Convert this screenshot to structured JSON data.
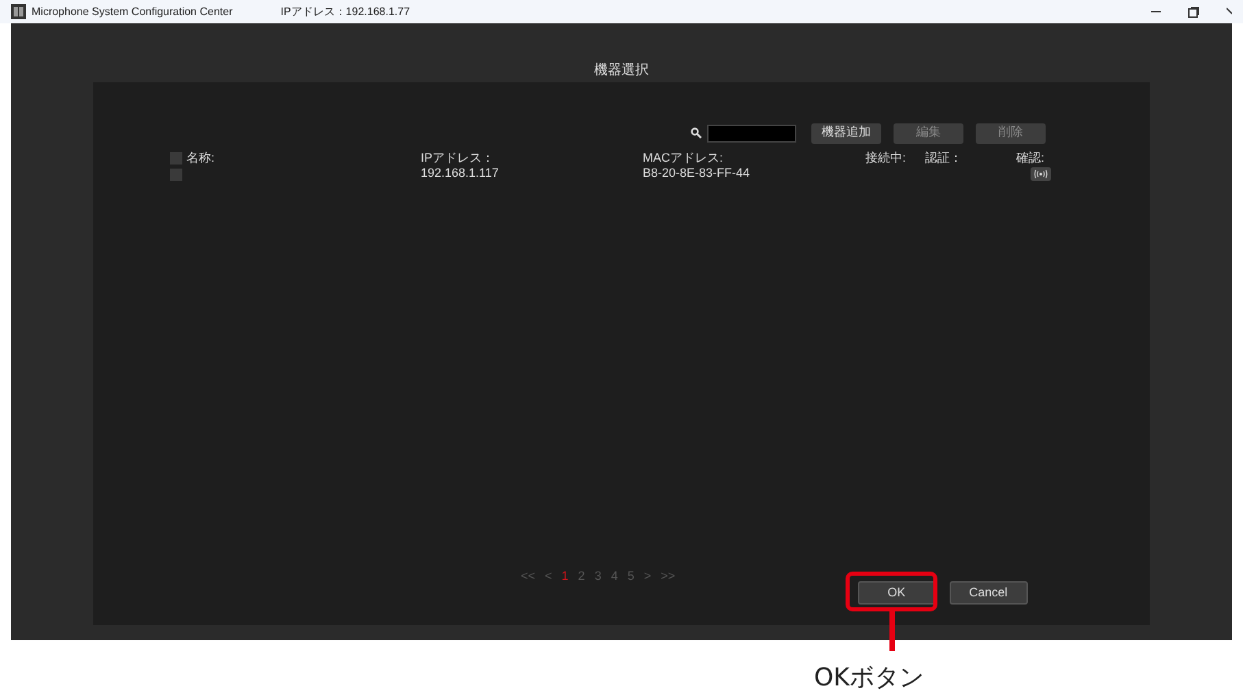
{
  "window": {
    "title": "Microphone System Configuration Center",
    "ip_label": "IPアドレス：192.168.1.77"
  },
  "dialog": {
    "title": "機器選択"
  },
  "toolbar": {
    "buttons": [
      {
        "label": "機器追加",
        "disabled": false
      },
      {
        "label": "編集",
        "disabled": true
      },
      {
        "label": "削除",
        "disabled": true
      }
    ]
  },
  "table": {
    "columns": [
      "名称:",
      "IPアドレス：",
      "MACアドレス:",
      "接続中:",
      "認証：",
      "確認:"
    ],
    "header_checked": false,
    "rows": [
      {
        "checked": false,
        "name": "",
        "ip": "192.168.1.117",
        "mac": "B8-20-8E-83-FF-44"
      }
    ]
  },
  "pagination": [
    {
      "label": "<<",
      "selected": false
    },
    {
      "label": "<",
      "selected": false
    },
    {
      "label": "1",
      "selected": true
    },
    {
      "label": "2",
      "selected": false
    },
    {
      "label": "3",
      "selected": false
    },
    {
      "label": "4",
      "selected": false
    },
    {
      "label": "5",
      "selected": false
    },
    {
      "label": ">",
      "selected": false
    },
    {
      "label": ">>",
      "selected": false
    }
  ],
  "buttons": [
    "OK",
    "Cancel"
  ],
  "callout": {
    "label": "OKボタン"
  }
}
